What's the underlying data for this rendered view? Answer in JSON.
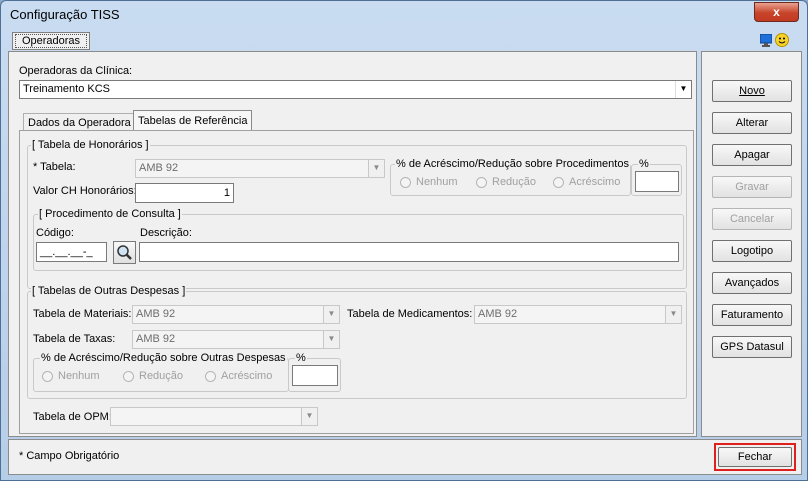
{
  "window": {
    "title": "Configuração TISS",
    "close_label": "x"
  },
  "top_tab": {
    "label": "Operadoras"
  },
  "operadoras": {
    "label": "Operadoras da Clínica:",
    "value": "Treinamento KCS"
  },
  "tabs": [
    {
      "label": "Dados da Operadora"
    },
    {
      "label": "Tabelas de Referência"
    }
  ],
  "honorarios": {
    "group_label": "[ Tabela de Honorários ]",
    "tabela_label": "* Tabela:",
    "tabela_value": "AMB 92",
    "valor_ch_label": "Valor CH Honorários:",
    "valor_ch_value": "1",
    "acrescimo_group_label": "% de Acréscimo/Redução sobre Procedimentos",
    "pct_label": "%",
    "radio_nenhum": "Nenhum",
    "radio_reducao": "Redução",
    "radio_acrescimo": "Acréscimo",
    "consulta_group_label": "[ Procedimento de Consulta ]",
    "codigo_label": "Código:",
    "codigo_value": "__.__.__-_",
    "descricao_label": "Descrição:"
  },
  "outras": {
    "group_label": "[ Tabelas de Outras Despesas ]",
    "materiais_label": "Tabela de Materiais:",
    "materiais_value": "AMB 92",
    "medicamentos_label": "Tabela de Medicamentos:",
    "medicamentos_value": "AMB 92",
    "taxas_label": "Tabela de Taxas:",
    "taxas_value": "AMB 92",
    "acrescimo_group_label": "% de Acréscimo/Redução sobre Outras Despesas",
    "pct_label": "%",
    "radio_nenhum": "Nenhum",
    "radio_reducao": "Redução",
    "radio_acrescimo": "Acréscimo"
  },
  "opm": {
    "label": "Tabela de OPM:",
    "value": ""
  },
  "buttons": {
    "novo": "Novo",
    "alterar": "Alterar",
    "apagar": "Apagar",
    "gravar": "Gravar",
    "cancelar": "Cancelar",
    "logotipo": "Logotipo",
    "avancados": "Avançados",
    "faturamento": "Faturamento",
    "gps": "GPS Datasul",
    "fechar": "Fechar"
  },
  "footer": {
    "required_note": "* Campo Obrigatório"
  },
  "colors": {
    "highlight": "#e0201c",
    "accent": "#3399ff"
  }
}
